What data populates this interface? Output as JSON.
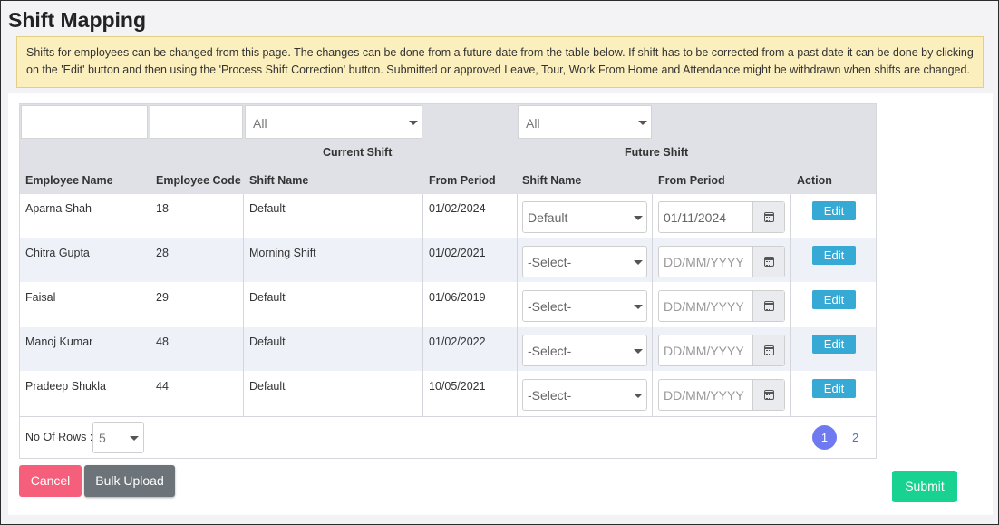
{
  "page": {
    "title": "Shift Mapping",
    "notice": "Shifts for employees can be changed from this page. The changes can be done from a future date from the table below. If shift has to be corrected from a past date it can be done by clicking on the 'Edit' button and then using the 'Process  Shift Correction' button. Submitted or approved Leave, Tour, Work From Home and Attendance might be withdrawn when shifts are changed."
  },
  "filters": {
    "employee_name": "",
    "employee_code": "",
    "current_shift": "All",
    "future_shift": "All"
  },
  "table": {
    "group_headers": {
      "current_shift": "Current Shift",
      "future_shift": "Future Shift"
    },
    "columns": {
      "employee_name": "Employee Name",
      "employee_code": "Employee Code",
      "current_shift_name": "Shift Name",
      "current_from_period": "From Period",
      "future_shift_name": "Shift Name",
      "future_from_period": "From Period",
      "action": "Action"
    },
    "rows": [
      {
        "name": "Aparna Shah",
        "code": "18",
        "shift": "Default",
        "from": "01/02/2024",
        "future_shift": "Default",
        "future_from": "01/11/2024",
        "action": "Edit"
      },
      {
        "name": "Chitra Gupta",
        "code": "28",
        "shift": "Morning Shift",
        "from": "01/02/2021",
        "future_shift": "-Select-",
        "future_from": "DD/MM/YYYY",
        "action": "Edit"
      },
      {
        "name": "Faisal",
        "code": "29",
        "shift": "Default",
        "from": "01/06/2019",
        "future_shift": "-Select-",
        "future_from": "DD/MM/YYYY",
        "action": "Edit"
      },
      {
        "name": "Manoj Kumar",
        "code": "48",
        "shift": "Default",
        "from": "01/02/2022",
        "future_shift": "-Select-",
        "future_from": "DD/MM/YYYY",
        "action": "Edit"
      },
      {
        "name": "Pradeep Shukla",
        "code": "44",
        "shift": "Default",
        "from": "10/05/2021",
        "future_shift": "-Select-",
        "future_from": "DD/MM/YYYY",
        "action": "Edit"
      }
    ]
  },
  "pagination": {
    "rows_label": "No Of Rows :",
    "rows_value": "5",
    "pages": [
      "1",
      "2"
    ],
    "current_page": "1"
  },
  "buttons": {
    "cancel": "Cancel",
    "bulk_upload": "Bulk Upload",
    "submit": "Submit"
  },
  "colors": {
    "notice_bg": "#fcefbe",
    "edit": "#36a9d4",
    "cancel": "#f55f7b",
    "bulk_upload": "#6c7379",
    "submit": "#18d292",
    "active_page": "#6f79f0"
  },
  "icons": {
    "dropdown": "caret-down-icon",
    "date": "calendar-icon"
  }
}
